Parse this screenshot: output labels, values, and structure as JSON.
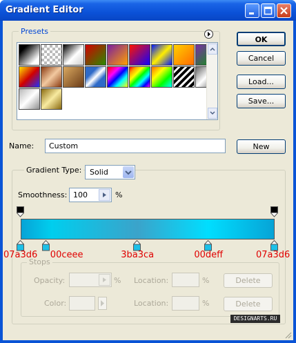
{
  "window": {
    "title": "Gradient Editor"
  },
  "presets": {
    "legend": "Presets",
    "swatches": [
      "linear-gradient(135deg,#000 20%,#fff 80%)",
      "repeating-conic-gradient(#bbb 0 25%,#fff 0 50%) 0 0/8px 8px",
      "linear-gradient(135deg,#000,#fff 55%,#ccc)",
      "linear-gradient(135deg,#d40000,#2a8a00)",
      "linear-gradient(135deg,#7a1fa0,#ffa000)",
      "linear-gradient(135deg,#ff1400,#1000ff)",
      "linear-gradient(135deg,#0018ff,#ffee00,#0018ff)",
      "linear-gradient(135deg,#ffd000,#ff6a00)",
      "linear-gradient(135deg,#7b2fa8,#0a9a0a)",
      "linear-gradient(135deg,#ffe000,#d00000,#2030ff)",
      "linear-gradient(135deg,#8a3a10,#f2c9a0,#8a3a10)",
      "linear-gradient(135deg,#d9a860,#6b3c18)",
      "linear-gradient(135deg,#2e6ac8 30%,#ffffff 50%,#2e6ac8 70%)",
      "linear-gradient(135deg,#ff0000,#ff00ff 30%,#0000ff 50%,#00ffff 70%,#ffff00)",
      "linear-gradient(135deg,red,orange,yellow,lime,cyan,blue,magenta)",
      "linear-gradient(135deg,#ff7000,#ffff00,#00ff00,#00ffff)",
      "repeating-linear-gradient(135deg,#000 0 4px,#fff 4px 7px)",
      "linear-gradient(135deg,#666,#fff,#666)",
      "linear-gradient(135deg,#b8b8b8,#ffffff,#909090)",
      "linear-gradient(135deg,#8a6a10,#f8eaa0,#8a6a10)"
    ]
  },
  "buttons": {
    "ok": "OK",
    "cancel": "Cancel",
    "load": "Load...",
    "save": "Save...",
    "new": "New",
    "delete_opacity": "Delete",
    "delete_color": "Delete"
  },
  "name_row": {
    "label": "Name:",
    "value": "Custom"
  },
  "gradient_type": {
    "label": "Gradient Type:",
    "value": "Solid"
  },
  "smoothness": {
    "label": "Smoothness:",
    "value": "100",
    "unit": "%"
  },
  "gradient": {
    "css": "linear-gradient(to right,#07a3d6 0%,#00ceee 12%,#3ba3ca 46%,#00deff 74%,#07a3d6 100%)",
    "color_stops": [
      {
        "label": "07a3d6",
        "position": 0
      },
      {
        "label": "00ceee",
        "position": 10
      },
      {
        "label": "3ba3ca",
        "position": 46
      },
      {
        "label": "00deff",
        "position": 74
      },
      {
        "label": "07a3d6",
        "position": 100
      }
    ],
    "opacity_stops": [
      0,
      100
    ]
  },
  "stops": {
    "legend": "Stops",
    "opacity_label": "Opacity:",
    "opacity_unit": "%",
    "location_label": "Location:",
    "location_unit": "%",
    "color_label": "Color:",
    "color_location_label": "Location:",
    "color_location_unit": "%"
  },
  "watermark": "DESIGNARTS.RU"
}
